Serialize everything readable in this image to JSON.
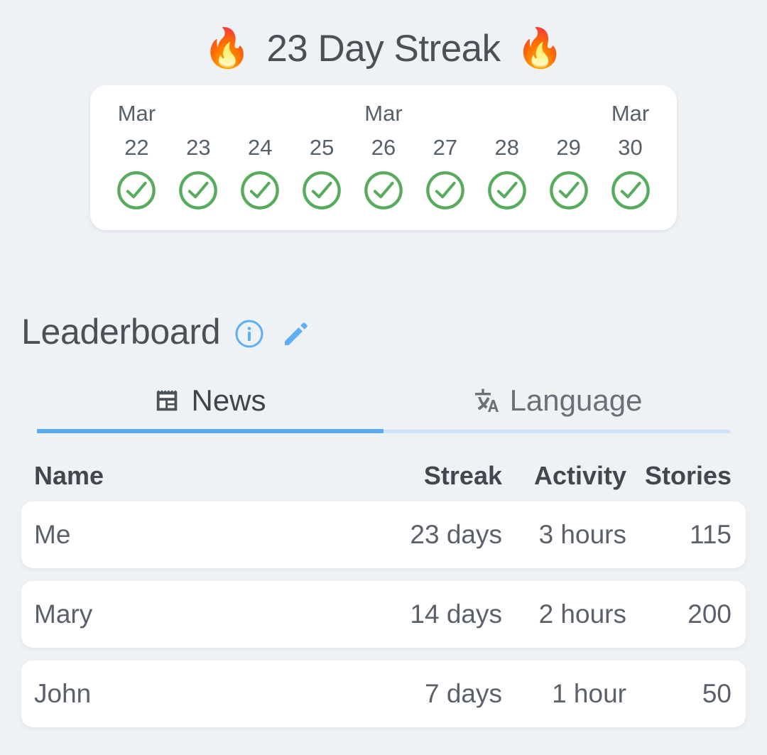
{
  "header": {
    "flame_left": "🔥",
    "flame_right": "🔥",
    "title": "23 Day Streak"
  },
  "calendar": {
    "days": [
      {
        "month": "Mar",
        "day": "22",
        "checked": true
      },
      {
        "month": "",
        "day": "23",
        "checked": true
      },
      {
        "month": "",
        "day": "24",
        "checked": true
      },
      {
        "month": "",
        "day": "25",
        "checked": true
      },
      {
        "month": "Mar",
        "day": "26",
        "checked": true
      },
      {
        "month": "",
        "day": "27",
        "checked": true
      },
      {
        "month": "",
        "day": "28",
        "checked": true
      },
      {
        "month": "",
        "day": "29",
        "checked": true
      },
      {
        "month": "Mar",
        "day": "30",
        "checked": true
      }
    ],
    "check_color": "#57ab5c"
  },
  "leaderboard": {
    "title": "Leaderboard",
    "info_icon": "info-circle-icon",
    "edit_icon": "pencil-icon",
    "icon_color": "#5eaef5"
  },
  "tabs": [
    {
      "label": "News",
      "icon": "newspaper-icon",
      "active": true
    },
    {
      "label": "Language",
      "icon": "translate-icon",
      "active": false
    }
  ],
  "table": {
    "columns": [
      "Name",
      "Streak",
      "Activity",
      "Stories"
    ],
    "rows": [
      {
        "name": "Me",
        "streak": "23 days",
        "activity": "3 hours",
        "stories": "115"
      },
      {
        "name": "Mary",
        "streak": "14 days",
        "activity": "2 hours",
        "stories": "200"
      },
      {
        "name": "John",
        "streak": "7 days",
        "activity": "1 hour",
        "stories": "50"
      }
    ]
  },
  "colors": {
    "background": "#eff2f5",
    "card": "#ffffff",
    "accent": "#5aaaf0",
    "accent_light": "#cfe4f8",
    "green": "#57ab5c",
    "text": "#4a5058"
  }
}
